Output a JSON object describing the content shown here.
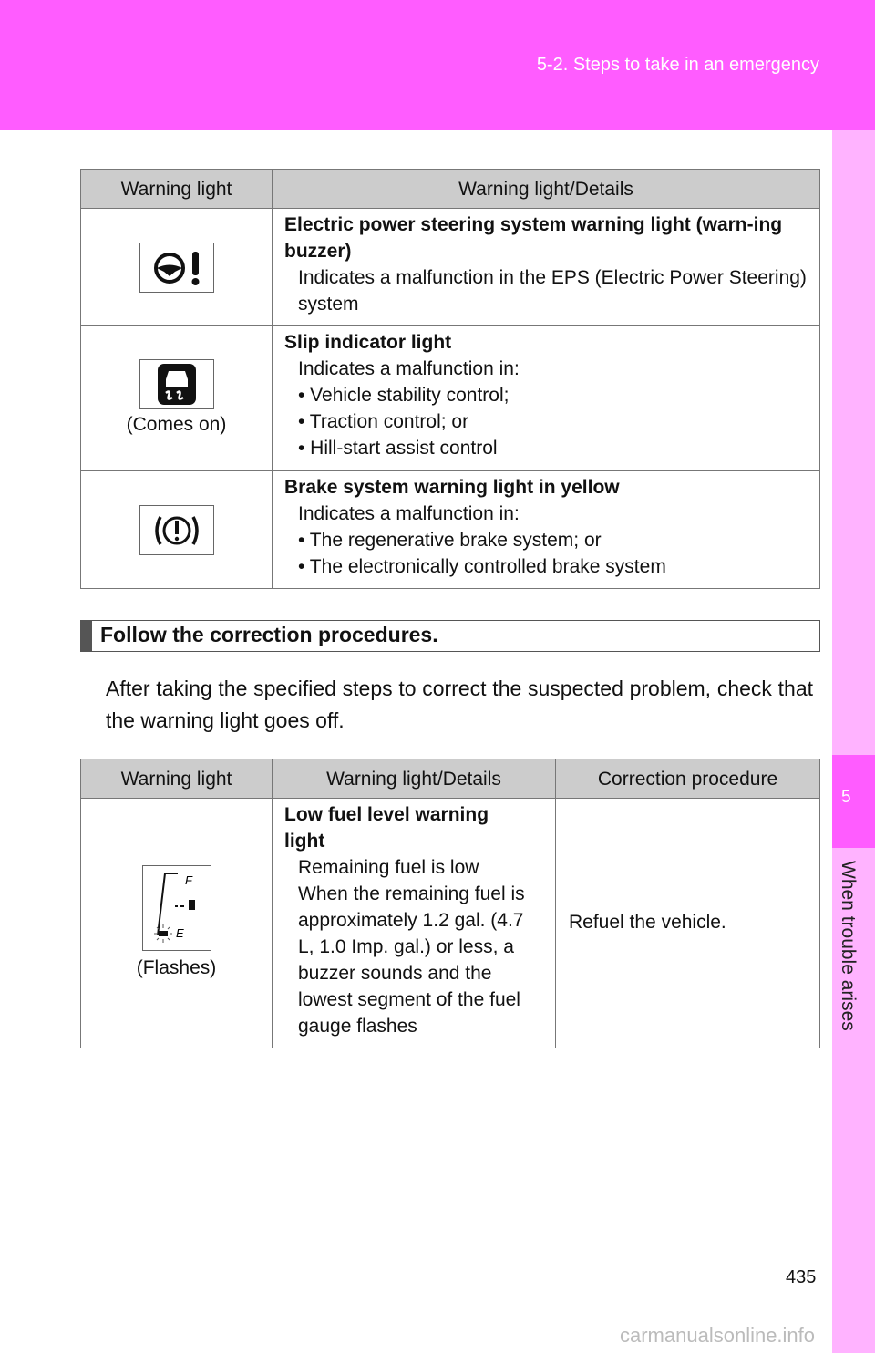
{
  "header": {
    "section": "5-2. Steps to take in an emergency"
  },
  "side_tab": {
    "number": "5",
    "label": "When trouble arises"
  },
  "colors": {
    "header": "#ff5cff",
    "sidebar": "#ffb3ff"
  },
  "table1": {
    "headers": [
      "Warning light",
      "Warning light/Details"
    ],
    "rows": [
      {
        "icon": "power-steering-warning-icon",
        "caption": "",
        "title": "Electric power steering system warning light (warn-ing buzzer)",
        "lines": [
          "Indicates a malfunction in the EPS (Electric Power Steering) system"
        ]
      },
      {
        "icon": "slip-indicator-icon",
        "caption": "(Comes on)",
        "title": "Slip indicator light",
        "lines": [
          "Indicates a malfunction in:",
          "• Vehicle stability control;",
          "• Traction control; or",
          "• Hill-start assist control"
        ]
      },
      {
        "icon": "brake-warning-icon",
        "caption": "",
        "title": "Brake system warning light in yellow",
        "lines": [
          "Indicates a malfunction in:",
          "• The regenerative brake system; or",
          "• The electronically controlled brake system"
        ]
      }
    ]
  },
  "section": {
    "title": "Follow the correction procedures."
  },
  "paragraph": "After taking the specified steps to correct the suspected problem, check that the warning light goes off.",
  "table2": {
    "headers": [
      "Warning light",
      "Warning light/Details",
      "Correction procedure"
    ],
    "rows": [
      {
        "icon": "fuel-gauge-icon",
        "caption": "(Flashes)",
        "title": "Low fuel level warning light",
        "lines": [
          "Remaining fuel is low",
          "When the remaining fuel is approximately 1.2 gal. (4.7 L, 1.0 Imp. gal.) or less, a buzzer sounds and the lowest segment of the fuel gauge flashes"
        ],
        "procedure": "Refuel the vehicle."
      }
    ]
  },
  "page_number": "435",
  "watermark": "carmanualsonline.info"
}
